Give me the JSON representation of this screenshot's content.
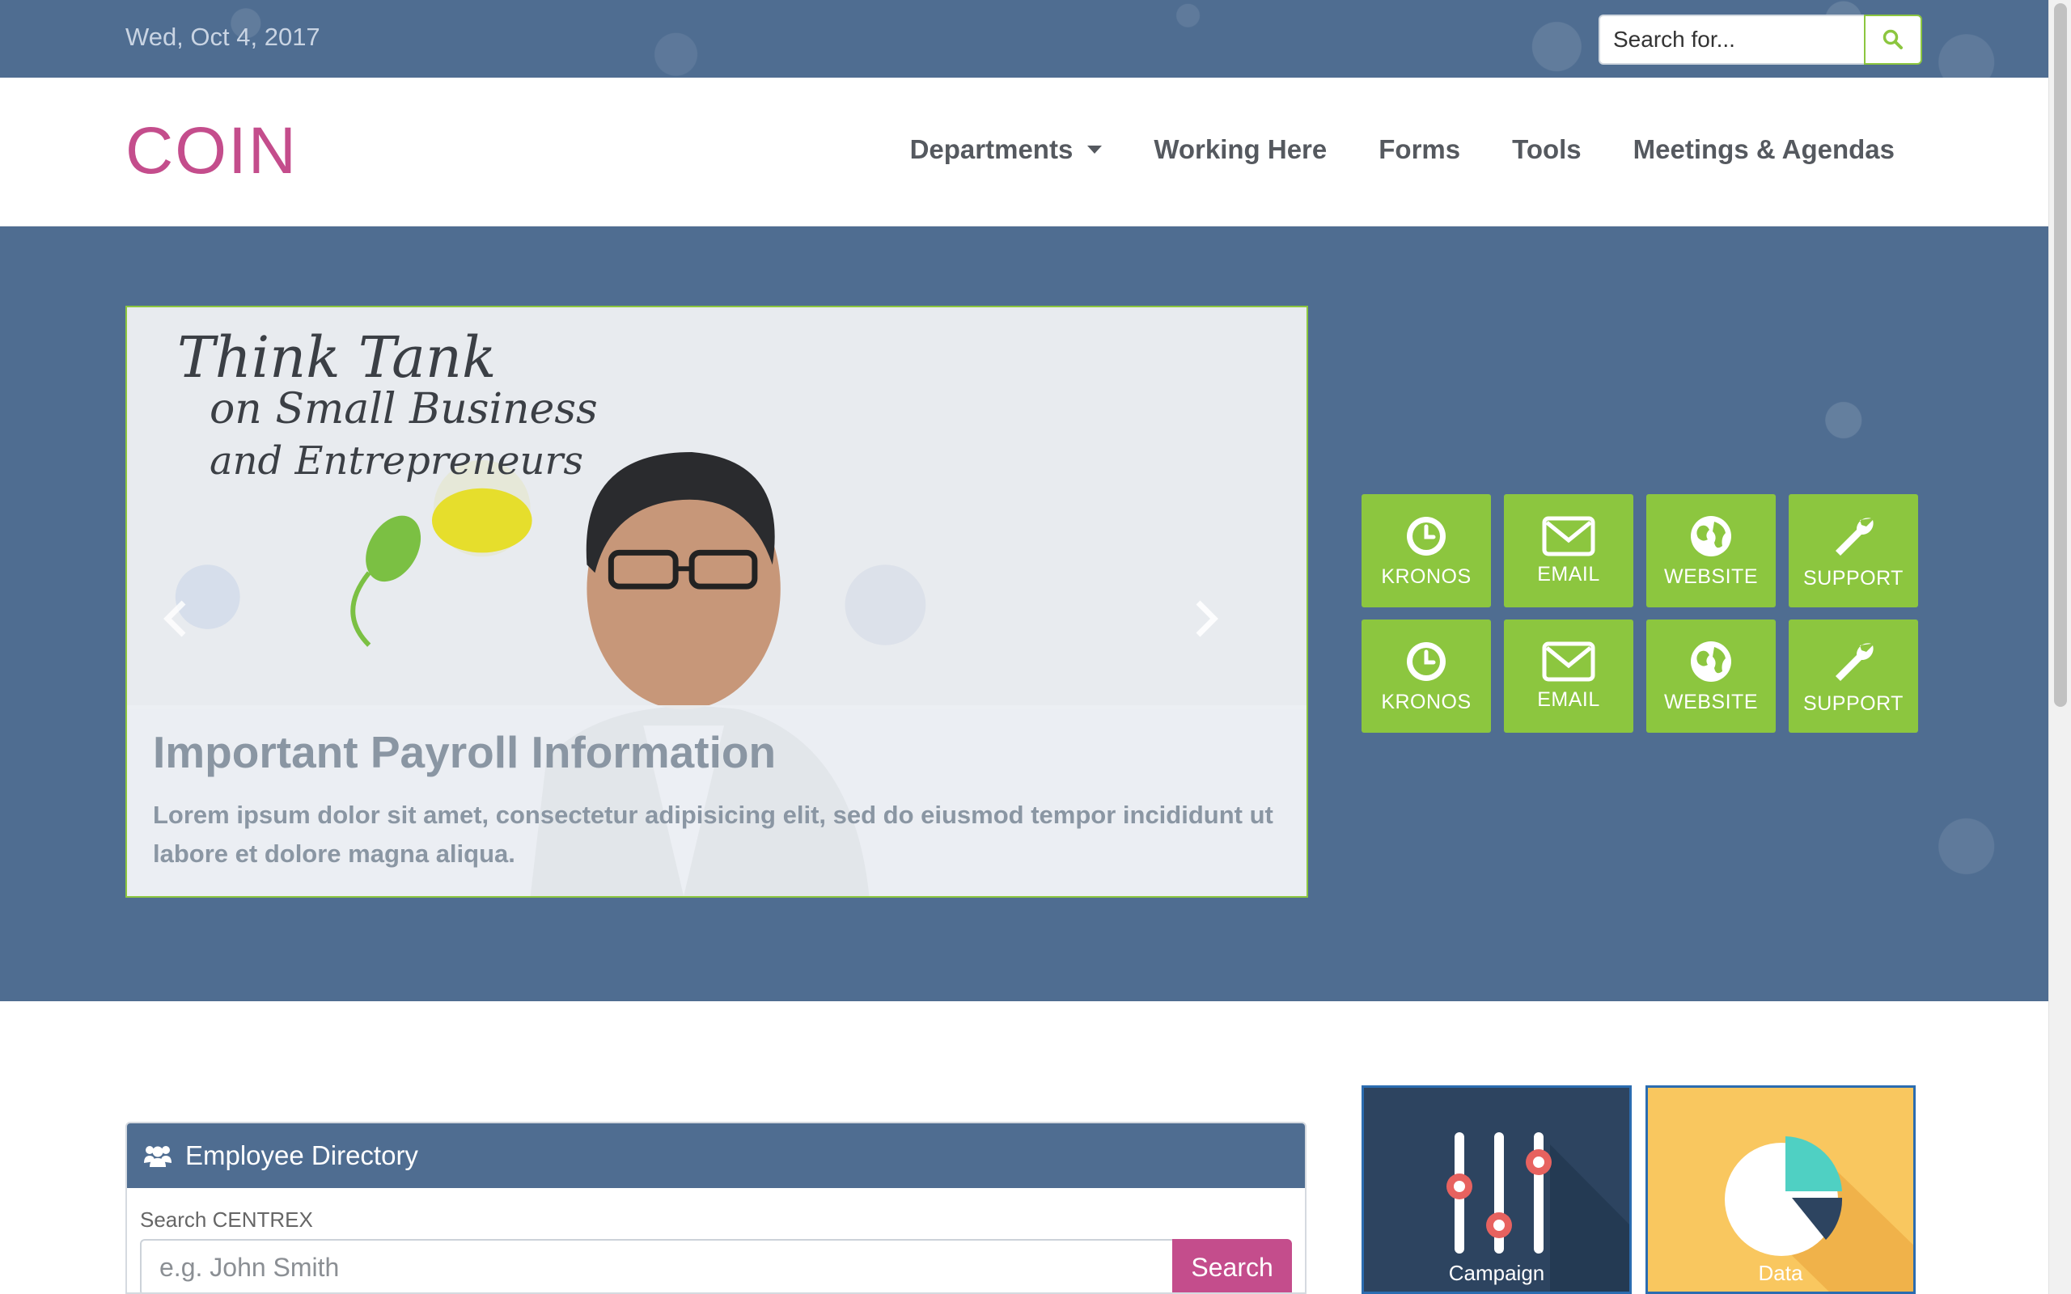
{
  "topbar": {
    "date": "Wed, Oct 4, 2017",
    "search_placeholder": "Search for..."
  },
  "header": {
    "logo": "COIN",
    "nav": [
      {
        "label": "Departments",
        "has_dropdown": true
      },
      {
        "label": "Working Here"
      },
      {
        "label": "Forms"
      },
      {
        "label": "Tools"
      },
      {
        "label": "Meetings & Agendas"
      }
    ]
  },
  "carousel": {
    "heading": "Important Payroll Information",
    "text": "Lorem ipsum dolor sit amet, consectetur adipisicing elit, sed do eiusmod tempor incididunt ut labore et dolore magna aliqua.",
    "whiteboard_text": [
      "Think Tank",
      "on Small Business",
      "and Entrepreneurs"
    ]
  },
  "quick_links": [
    {
      "label": "KRONOS",
      "icon": "clock-icon"
    },
    {
      "label": "EMAIL",
      "icon": "envelope-icon"
    },
    {
      "label": "WEBSITE",
      "icon": "globe-icon"
    },
    {
      "label": "SUPPORT",
      "icon": "wrench-icon"
    },
    {
      "label": "KRONOS",
      "icon": "clock-icon"
    },
    {
      "label": "EMAIL",
      "icon": "envelope-icon"
    },
    {
      "label": "WEBSITE",
      "icon": "globe-icon"
    },
    {
      "label": "SUPPORT",
      "icon": "wrench-icon"
    }
  ],
  "directory": {
    "title": "Employee Directory",
    "search_label": "Search CENTREX",
    "placeholder": "e.g. John Smith",
    "button": "Search"
  },
  "cards": [
    {
      "label": "Campaign",
      "icon": "sliders-icon"
    },
    {
      "label": "Data",
      "icon": "pie-chart-icon"
    }
  ],
  "colors": {
    "accent_green": "#8cc63f",
    "brand_pink": "#c44d8c",
    "hero_blue": "#4f6d91",
    "card_dark": "#2d4460",
    "card_yellow": "#f9c75f"
  }
}
